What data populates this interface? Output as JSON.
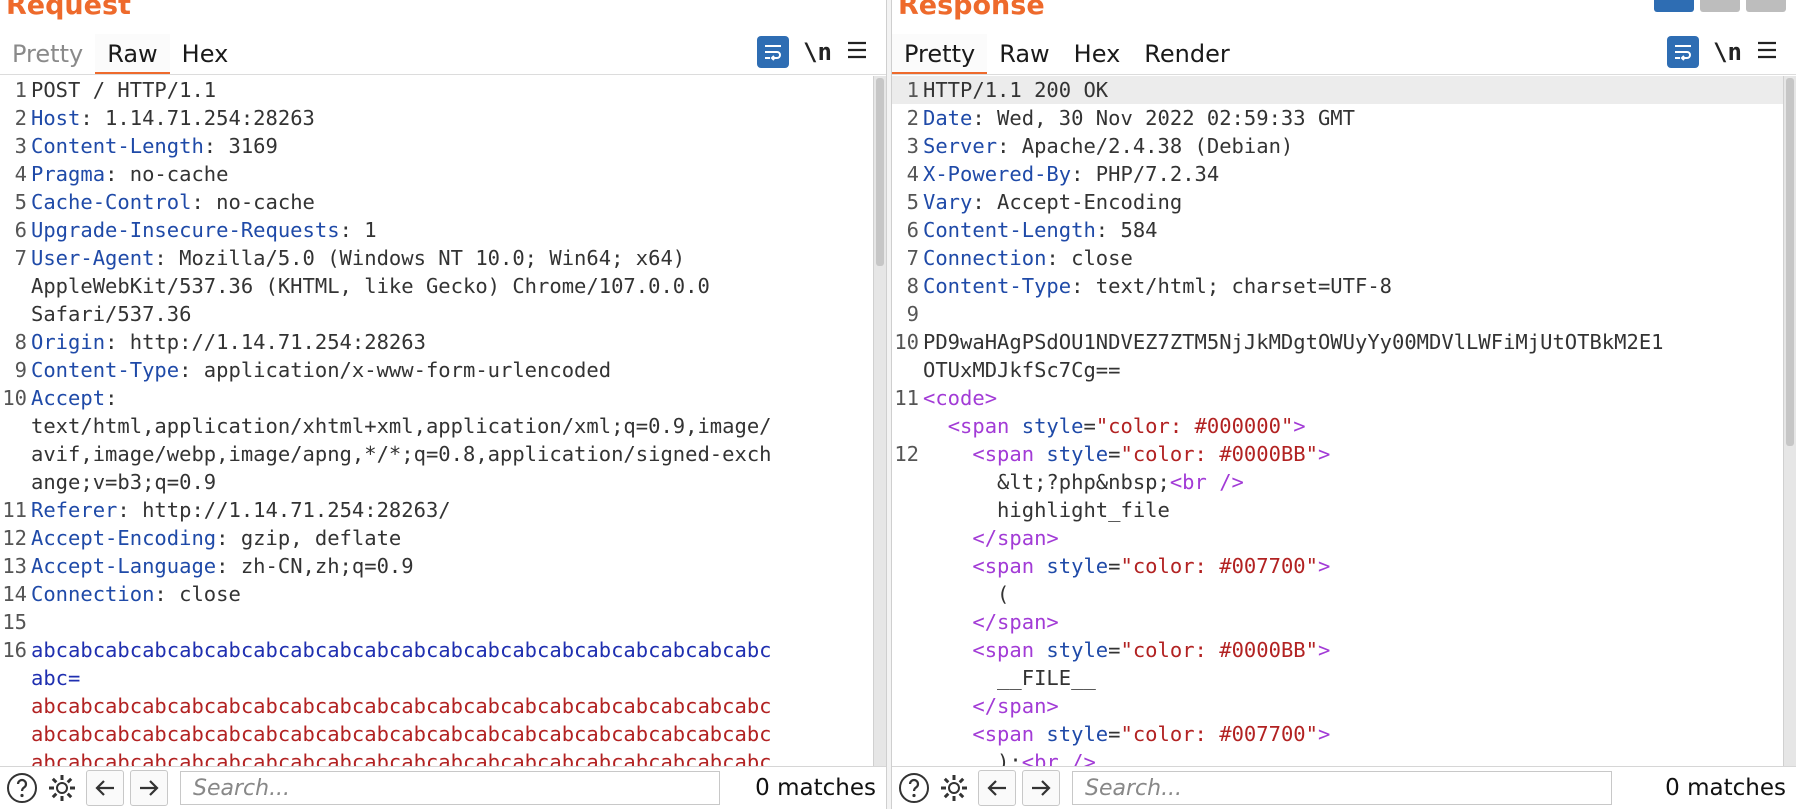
{
  "request": {
    "title": "Request",
    "tabs": [
      "Pretty",
      "Raw",
      "Hex"
    ],
    "active_tab": "Raw",
    "newline_label": "\\n",
    "search_placeholder": "Search...",
    "matches": "0 matches",
    "lines": [
      {
        "n": "1",
        "segs": [
          {
            "t": "POST / HTTP/1.1",
            "c": ""
          }
        ]
      },
      {
        "n": "2",
        "segs": [
          {
            "t": "Host",
            "c": "k"
          },
          {
            "t": ": 1.14.71.254:28263",
            "c": ""
          }
        ]
      },
      {
        "n": "3",
        "segs": [
          {
            "t": "Content-Length",
            "c": "k"
          },
          {
            "t": ": 3169",
            "c": ""
          }
        ]
      },
      {
        "n": "4",
        "segs": [
          {
            "t": "Pragma",
            "c": "k"
          },
          {
            "t": ": no-cache",
            "c": ""
          }
        ]
      },
      {
        "n": "5",
        "segs": [
          {
            "t": "Cache-Control",
            "c": "k"
          },
          {
            "t": ": no-cache",
            "c": ""
          }
        ]
      },
      {
        "n": "6",
        "segs": [
          {
            "t": "Upgrade-Insecure-Requests",
            "c": "k"
          },
          {
            "t": ": 1",
            "c": ""
          }
        ]
      },
      {
        "n": "7",
        "segs": [
          {
            "t": "User-Agent",
            "c": "k"
          },
          {
            "t": ": Mozilla/5.0 (Windows NT 10.0; Win64; x64)",
            "c": ""
          }
        ]
      },
      {
        "n": "",
        "segs": [
          {
            "t": "AppleWebKit/537.36 (KHTML, like Gecko) Chrome/107.0.0.0",
            "c": ""
          }
        ]
      },
      {
        "n": "",
        "segs": [
          {
            "t": "Safari/537.36",
            "c": ""
          }
        ]
      },
      {
        "n": "8",
        "segs": [
          {
            "t": "Origin",
            "c": "k"
          },
          {
            "t": ": http://1.14.71.254:28263",
            "c": ""
          }
        ]
      },
      {
        "n": "9",
        "segs": [
          {
            "t": "Content-Type",
            "c": "k"
          },
          {
            "t": ": application/x-www-form-urlencoded",
            "c": ""
          }
        ]
      },
      {
        "n": "10",
        "segs": [
          {
            "t": "Accept",
            "c": "k"
          },
          {
            "t": ":",
            "c": ""
          }
        ]
      },
      {
        "n": "",
        "segs": [
          {
            "t": "text/html,application/xhtml+xml,application/xml;q=0.9,image/",
            "c": ""
          }
        ]
      },
      {
        "n": "",
        "segs": [
          {
            "t": "avif,image/webp,image/apng,*/*;q=0.8,application/signed-exch",
            "c": ""
          }
        ]
      },
      {
        "n": "",
        "segs": [
          {
            "t": "ange;v=b3;q=0.9",
            "c": ""
          }
        ]
      },
      {
        "n": "11",
        "segs": [
          {
            "t": "Referer",
            "c": "k"
          },
          {
            "t": ": http://1.14.71.254:28263/",
            "c": ""
          }
        ]
      },
      {
        "n": "12",
        "segs": [
          {
            "t": "Accept-Encoding",
            "c": "k"
          },
          {
            "t": ": gzip, deflate",
            "c": ""
          }
        ]
      },
      {
        "n": "13",
        "segs": [
          {
            "t": "Accept-Language",
            "c": "k"
          },
          {
            "t": ": zh-CN,zh;q=0.9",
            "c": ""
          }
        ]
      },
      {
        "n": "14",
        "segs": [
          {
            "t": "Connection",
            "c": "k"
          },
          {
            "t": ": close",
            "c": ""
          }
        ]
      },
      {
        "n": "15",
        "segs": [
          {
            "t": "",
            "c": ""
          }
        ]
      },
      {
        "n": "16",
        "segs": [
          {
            "t": "abcabcabcabcabcabcabcabcabcabcabcabcabcabcabcabcabcabcabcabc",
            "c": "blue"
          }
        ]
      },
      {
        "n": "",
        "segs": [
          {
            "t": "abc=",
            "c": "blue"
          }
        ]
      },
      {
        "n": "",
        "segs": [
          {
            "t": "abcabcabcabcabcabcabcabcabcabcabcabcabcabcabcabcabcabcabcabc",
            "c": "red"
          }
        ]
      },
      {
        "n": "",
        "segs": [
          {
            "t": "abcabcabcabcabcabcabcabcabcabcabcabcabcabcabcabcabcabcabcabc",
            "c": "red"
          }
        ]
      },
      {
        "n": "",
        "segs": [
          {
            "t": "abcabcabcabcabcabcabcabcabcabcabcabcabcabcabcabcabcabcabcabc",
            "c": "red"
          }
        ]
      }
    ]
  },
  "response": {
    "title": "Response",
    "tabs": [
      "Pretty",
      "Raw",
      "Hex",
      "Render"
    ],
    "active_tab": "Pretty",
    "newline_label": "\\n",
    "search_placeholder": "Search...",
    "matches": "0 matches",
    "lines": [
      {
        "n": "1",
        "cur": true,
        "segs": [
          {
            "t": "HTTP/1.1 200 OK",
            "c": ""
          }
        ]
      },
      {
        "n": "2",
        "segs": [
          {
            "t": "Date",
            "c": "k"
          },
          {
            "t": ": Wed, 30 Nov 2022 02:59:33 GMT",
            "c": ""
          }
        ]
      },
      {
        "n": "3",
        "segs": [
          {
            "t": "Server",
            "c": "k"
          },
          {
            "t": ": Apache/2.4.38 (Debian)",
            "c": ""
          }
        ]
      },
      {
        "n": "4",
        "segs": [
          {
            "t": "X-Powered-By",
            "c": "k"
          },
          {
            "t": ": PHP/7.2.34",
            "c": ""
          }
        ]
      },
      {
        "n": "5",
        "segs": [
          {
            "t": "Vary",
            "c": "k"
          },
          {
            "t": ": Accept-Encoding",
            "c": ""
          }
        ]
      },
      {
        "n": "6",
        "segs": [
          {
            "t": "Content-Length",
            "c": "k"
          },
          {
            "t": ": 584",
            "c": ""
          }
        ]
      },
      {
        "n": "7",
        "segs": [
          {
            "t": "Connection",
            "c": "k"
          },
          {
            "t": ": close",
            "c": ""
          }
        ]
      },
      {
        "n": "8",
        "segs": [
          {
            "t": "Content-Type",
            "c": "k"
          },
          {
            "t": ": text/html; charset=UTF-8",
            "c": ""
          }
        ]
      },
      {
        "n": "9",
        "segs": [
          {
            "t": "",
            "c": ""
          }
        ]
      },
      {
        "n": "10",
        "segs": [
          {
            "t": "PD9waHAgPSdOU1NDVEZ7ZTM5NjJkMDgtOWUyYy00MDVlLWFiMjUtOTBkM2E1",
            "c": ""
          }
        ]
      },
      {
        "n": "",
        "segs": [
          {
            "t": "OTUxMDJkfSc7Cg==",
            "c": ""
          }
        ]
      },
      {
        "n": "11",
        "segs": [
          {
            "t": "<code>",
            "c": "tag"
          }
        ]
      },
      {
        "n": "",
        "segs": [
          {
            "t": "  ",
            "c": ""
          },
          {
            "t": "<span",
            "c": "tag"
          },
          {
            "t": " style",
            "c": "attr"
          },
          {
            "t": "=",
            "c": ""
          },
          {
            "t": "\"color: #000000\"",
            "c": "val"
          },
          {
            "t": ">",
            "c": "tag"
          }
        ]
      },
      {
        "n": "12",
        "segs": [
          {
            "t": "    ",
            "c": ""
          },
          {
            "t": "<span",
            "c": "tag"
          },
          {
            "t": " style",
            "c": "attr"
          },
          {
            "t": "=",
            "c": ""
          },
          {
            "t": "\"color: #0000BB\"",
            "c": "val"
          },
          {
            "t": ">",
            "c": "tag"
          }
        ]
      },
      {
        "n": "",
        "segs": [
          {
            "t": "      &lt;?php&nbsp;",
            "c": ""
          },
          {
            "t": "<br />",
            "c": "tag"
          }
        ]
      },
      {
        "n": "",
        "segs": [
          {
            "t": "      highlight_file",
            "c": ""
          }
        ]
      },
      {
        "n": "",
        "segs": [
          {
            "t": "    ",
            "c": ""
          },
          {
            "t": "</span>",
            "c": "tag"
          }
        ]
      },
      {
        "n": "",
        "segs": [
          {
            "t": "    ",
            "c": ""
          },
          {
            "t": "<span",
            "c": "tag"
          },
          {
            "t": " style",
            "c": "attr"
          },
          {
            "t": "=",
            "c": ""
          },
          {
            "t": "\"color: #007700\"",
            "c": "val"
          },
          {
            "t": ">",
            "c": "tag"
          }
        ]
      },
      {
        "n": "",
        "segs": [
          {
            "t": "      (",
            "c": ""
          }
        ]
      },
      {
        "n": "",
        "segs": [
          {
            "t": "    ",
            "c": ""
          },
          {
            "t": "</span>",
            "c": "tag"
          }
        ]
      },
      {
        "n": "",
        "segs": [
          {
            "t": "    ",
            "c": ""
          },
          {
            "t": "<span",
            "c": "tag"
          },
          {
            "t": " style",
            "c": "attr"
          },
          {
            "t": "=",
            "c": ""
          },
          {
            "t": "\"color: #0000BB\"",
            "c": "val"
          },
          {
            "t": ">",
            "c": "tag"
          }
        ]
      },
      {
        "n": "",
        "segs": [
          {
            "t": "      __FILE__",
            "c": ""
          }
        ]
      },
      {
        "n": "",
        "segs": [
          {
            "t": "    ",
            "c": ""
          },
          {
            "t": "</span>",
            "c": "tag"
          }
        ]
      },
      {
        "n": "",
        "segs": [
          {
            "t": "    ",
            "c": ""
          },
          {
            "t": "<span",
            "c": "tag"
          },
          {
            "t": " style",
            "c": "attr"
          },
          {
            "t": "=",
            "c": ""
          },
          {
            "t": "\"color: #007700\"",
            "c": "val"
          },
          {
            "t": ">",
            "c": "tag"
          }
        ]
      },
      {
        "n": "",
        "segs": [
          {
            "t": "      );",
            "c": ""
          },
          {
            "t": "<br />",
            "c": "tag"
          }
        ]
      }
    ]
  }
}
